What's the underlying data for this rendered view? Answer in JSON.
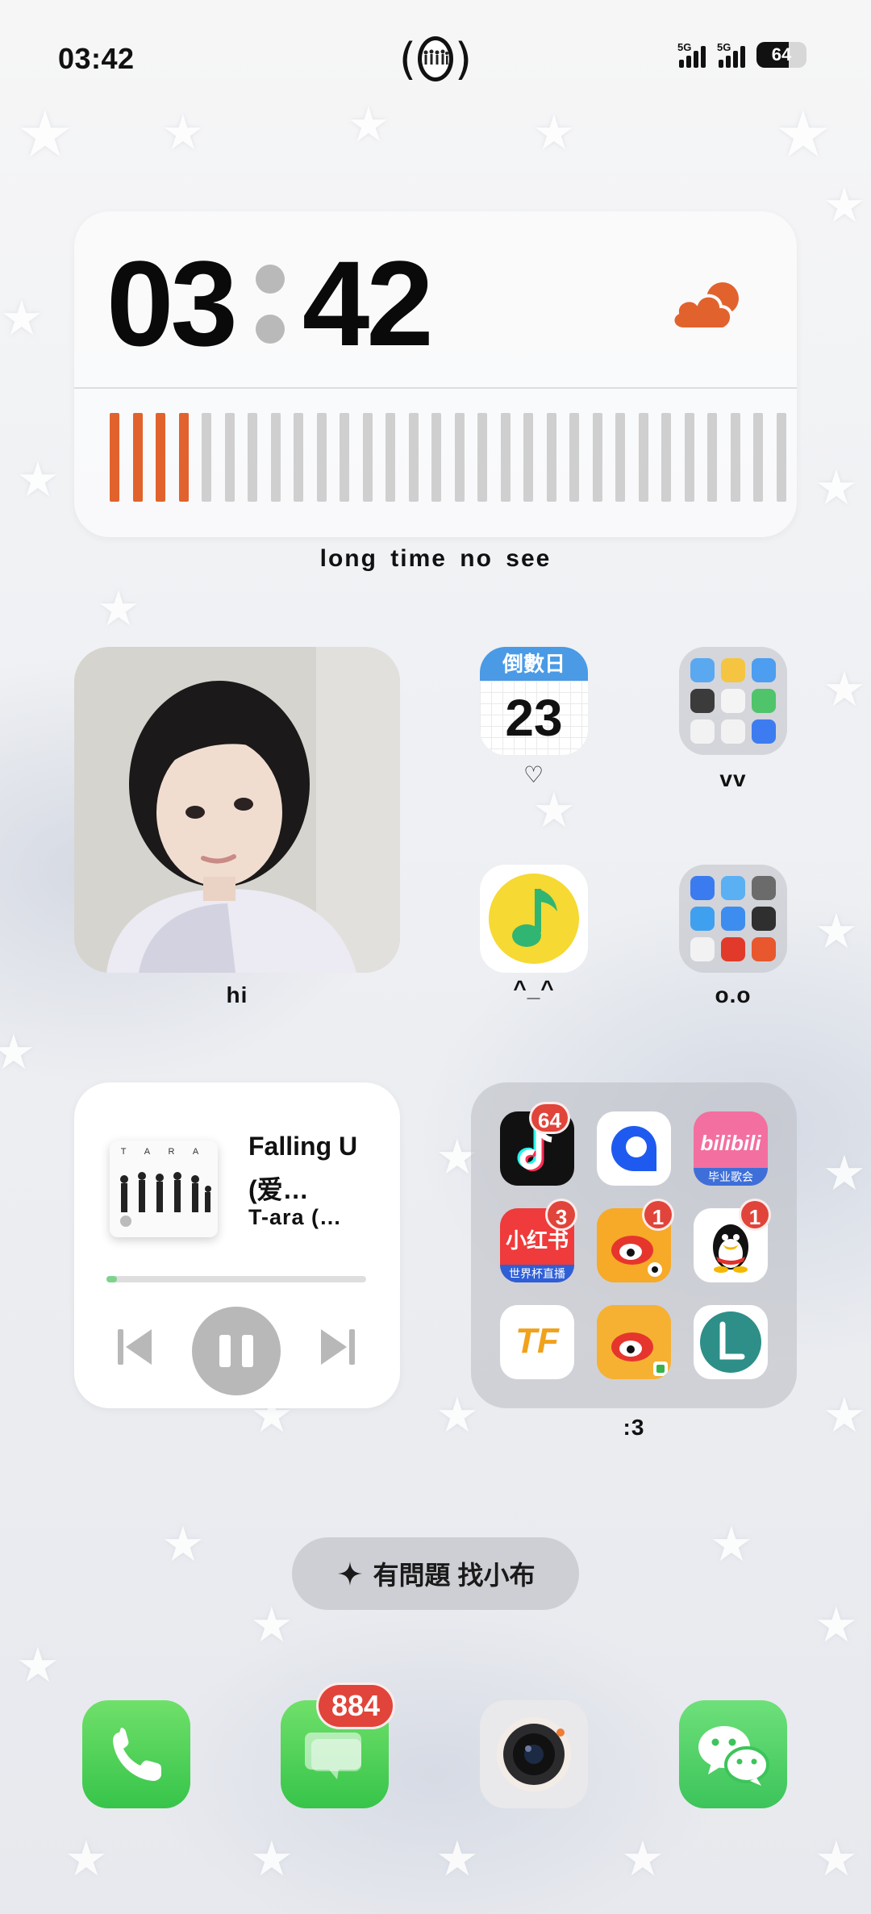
{
  "status_bar": {
    "time": "03:42",
    "battery": "64",
    "signal_1_label": "5G",
    "signal_2_label": "5G"
  },
  "clock_widget": {
    "hours": "03",
    "minutes": "42",
    "weather_icon": "cloud-moon-icon",
    "progress_bars_total": 30,
    "progress_bars_active": 4,
    "accent_color": "#e2622d",
    "caption": "long time no see"
  },
  "photo_widget": {
    "label": "hi"
  },
  "apps": {
    "countdown": {
      "header": "倒數日",
      "day": "23",
      "label": "♡"
    },
    "folder_vv": {
      "label": "vv"
    },
    "qq_music": {
      "label": "^_^"
    },
    "folder_oo": {
      "label": "o.o"
    }
  },
  "music_widget": {
    "album_header": "T A R A",
    "title": "Falling U (爱…",
    "artist": "T-ara (…",
    "progress": 0.04,
    "progress_color": "#7cd38e"
  },
  "big_folder": {
    "label": ":3",
    "apps": [
      {
        "name": "douyin",
        "badge": "64"
      },
      {
        "name": "quark",
        "badge": ""
      },
      {
        "name": "bilibili",
        "text": "bilibili",
        "subtext": "毕业歌会",
        "badge": ""
      },
      {
        "name": "xiaohongshu",
        "text": "小红书",
        "subtext": "世界杯直播",
        "badge": "3"
      },
      {
        "name": "weibo",
        "badge": "1"
      },
      {
        "name": "qq",
        "badge": "1"
      },
      {
        "name": "tencent-sports",
        "text": "TF",
        "badge": ""
      },
      {
        "name": "weibo-lite",
        "badge": ""
      },
      {
        "name": "l-app",
        "badge": ""
      }
    ]
  },
  "assistant": {
    "label": "有問題 找小布"
  },
  "dock": {
    "phone_badge": "",
    "messages_badge": "884",
    "camera_badge": "",
    "wechat_badge": ""
  }
}
